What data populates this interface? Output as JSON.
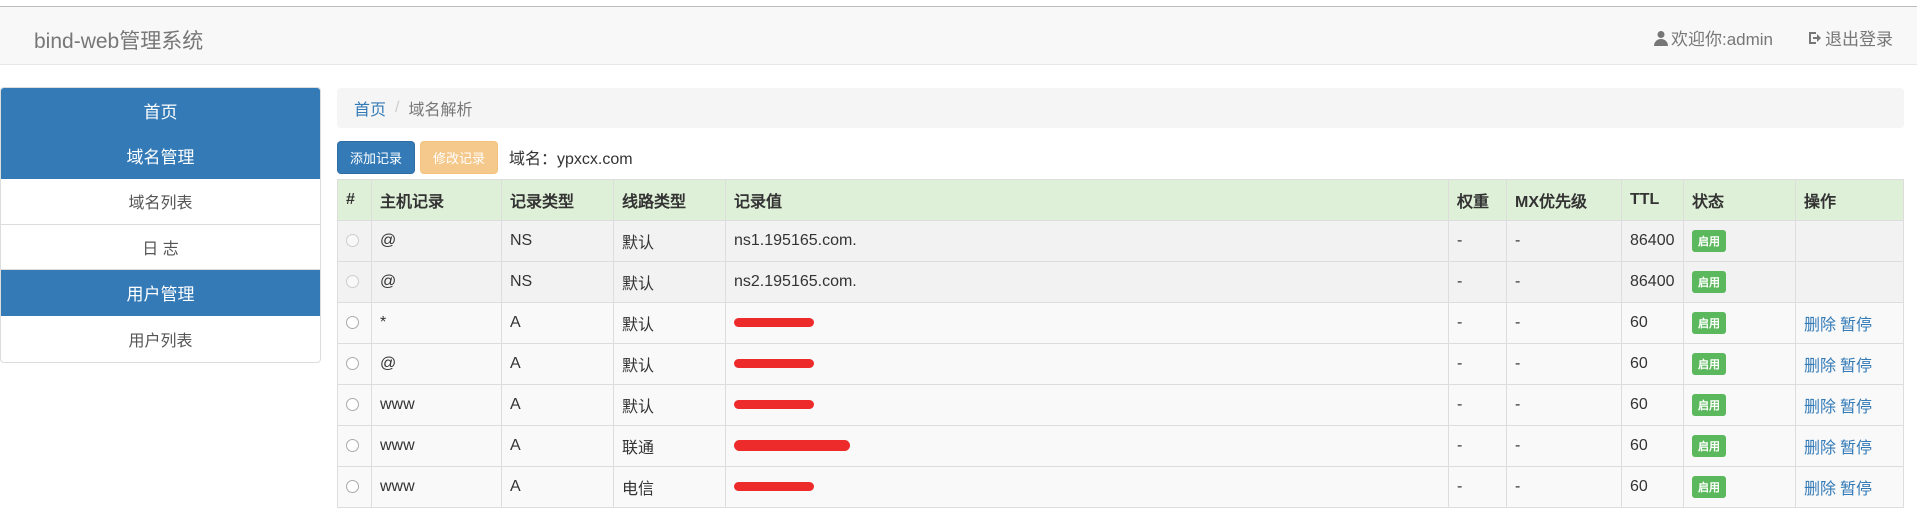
{
  "navbar": {
    "brand": "bind-web管理系统",
    "welcome": "欢迎你:admin",
    "logout": "退出登录"
  },
  "sidebar": {
    "items": [
      {
        "label": "首页",
        "active": true
      },
      {
        "label": "域名管理",
        "active": true
      },
      {
        "label": "域名列表",
        "active": false
      },
      {
        "label": "日 志",
        "active": false
      },
      {
        "label": "用户管理",
        "active": true
      },
      {
        "label": "用户列表",
        "active": false
      }
    ]
  },
  "breadcrumb": {
    "home": "首页",
    "separator": "/",
    "current": "域名解析"
  },
  "toolbar": {
    "add_label": "添加记录",
    "edit_label": "修改记录",
    "domain_text": "域名：ypxcx.com"
  },
  "table": {
    "headers": [
      "#",
      "主机记录",
      "记录类型",
      "线路类型",
      "记录值",
      "权重",
      "MX优先级",
      "TTL",
      "状态",
      "操作"
    ],
    "rows": [
      {
        "host": "@",
        "type": "NS",
        "line": "默认",
        "value": "ns1.195165.com.",
        "weight": "-",
        "mx": "-",
        "ttl": "86400",
        "status": "启用",
        "delete": "",
        "pause": ""
      },
      {
        "host": "@",
        "type": "NS",
        "line": "默认",
        "value": "ns2.195165.com.",
        "weight": "-",
        "mx": "-",
        "ttl": "86400",
        "status": "启用",
        "delete": "",
        "pause": ""
      },
      {
        "host": "*",
        "type": "A",
        "line": "默认",
        "value": "",
        "weight": "-",
        "mx": "-",
        "ttl": "60",
        "status": "启用",
        "delete": "删除",
        "pause": "暂停"
      },
      {
        "host": "@",
        "type": "A",
        "line": "默认",
        "value": "",
        "weight": "-",
        "mx": "-",
        "ttl": "60",
        "status": "启用",
        "delete": "删除",
        "pause": "暂停"
      },
      {
        "host": "www",
        "type": "A",
        "line": "默认",
        "value": "",
        "weight": "-",
        "mx": "-",
        "ttl": "60",
        "status": "启用",
        "delete": "删除",
        "pause": "暂停"
      },
      {
        "host": "www",
        "type": "A",
        "line": "联通",
        "value": "",
        "weight": "-",
        "mx": "-",
        "ttl": "60",
        "status": "启用",
        "delete": "删除",
        "pause": "暂停"
      },
      {
        "host": "www",
        "type": "A",
        "line": "电信",
        "value": "",
        "weight": "-",
        "mx": "-",
        "ttl": "60",
        "status": "启用",
        "delete": "删除",
        "pause": "暂停"
      }
    ]
  },
  "colors": {
    "primary": "#337ab7",
    "success": "#5cb85c",
    "warning": "#f0ad4e",
    "header_bg": "#dff0d8",
    "redaction": "#ee2b2b"
  }
}
